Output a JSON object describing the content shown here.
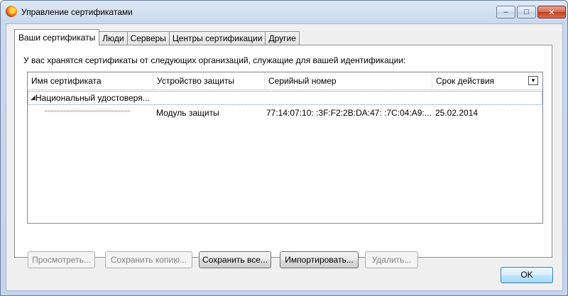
{
  "window": {
    "title": "Управление сертификатами",
    "minimize": "–",
    "maximize": "□",
    "close": "✕"
  },
  "tabs": [
    {
      "label": "Ваши сертификаты",
      "active": true
    },
    {
      "label": "Люди"
    },
    {
      "label": "Серверы"
    },
    {
      "label": "Центры сертификации"
    },
    {
      "label": "Другие"
    }
  ],
  "info_text": "У вас хранятся сертификаты от следующих организаций, служащие для вашей идентификации:",
  "table": {
    "columns": [
      "Имя сертификата",
      "Устройство защиты",
      "Серийный номер",
      "Срок действия"
    ],
    "group": "Национальный удостоверя...",
    "rows": [
      {
        "name": "",
        "device": "Модуль защиты",
        "serial": "77:14:07:10:  :3F:F2:2B:DA:47:  :7C:04:A9:...",
        "expires": "25.02.2014"
      }
    ]
  },
  "buttons": {
    "view": "Просмотреть...",
    "backup": "Сохранить копию...",
    "backup_all": "Сохранить все...",
    "import": "Импортировать...",
    "delete": "Удалить..."
  },
  "ok": "OK"
}
